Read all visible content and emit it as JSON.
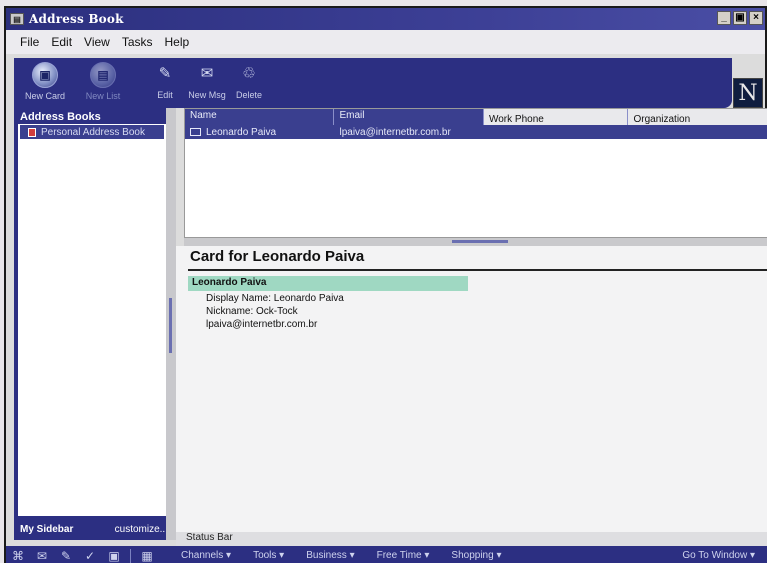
{
  "window": {
    "title": "Address Book",
    "app_icon": "addressbook-icon"
  },
  "title_buttons": {
    "minimize": "_",
    "maximize": "▣",
    "close": "×"
  },
  "menu": [
    "File",
    "Edit",
    "View",
    "Tasks",
    "Help"
  ],
  "toolbar": {
    "new_card": "New Card",
    "new_list": "New List",
    "edit": "Edit",
    "new_msg": "New Msg",
    "delete": "Delete"
  },
  "brand": "N",
  "sidebar": {
    "header": "Address Books",
    "items": [
      {
        "label": "Personal Address Book",
        "icon": "book-icon"
      }
    ],
    "footer_title": "My Sidebar",
    "footer_action": "customize..."
  },
  "list": {
    "columns": [
      "Name",
      "Email",
      "Work Phone",
      "Organization"
    ],
    "rows": [
      {
        "name": "Leonardo Paiva",
        "email": "lpaiva@internetbr.com.br",
        "phone": "",
        "org": ""
      }
    ]
  },
  "card": {
    "title": "Card for Leonardo Paiva",
    "name": "Leonardo Paiva",
    "lines": [
      "Display Name: Leonardo Paiva",
      "Nickname: Ock-Tock",
      "lpaiva@internetbr.com.br"
    ]
  },
  "status": "Status Bar",
  "taskbar": {
    "menus": [
      "Channels ▾",
      "Tools ▾",
      "Business ▾",
      "Free Time ▾",
      "Shopping ▾"
    ],
    "right": "Go To Window ▾"
  }
}
